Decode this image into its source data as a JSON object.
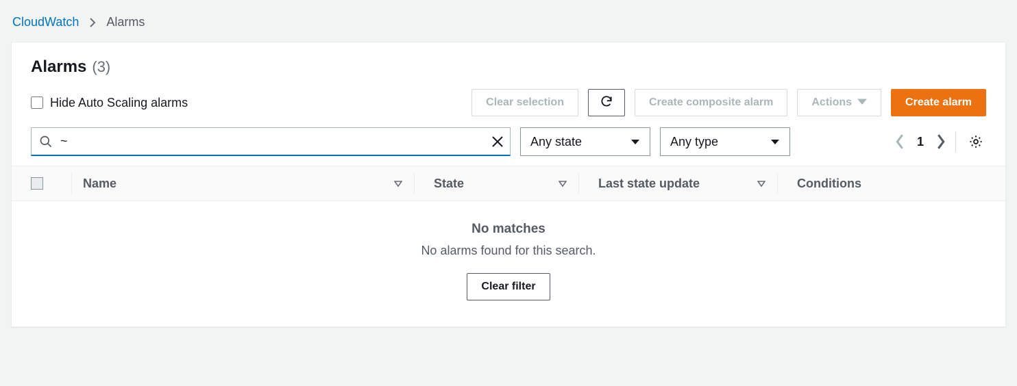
{
  "breadcrumb": {
    "root": "CloudWatch",
    "current": "Alarms"
  },
  "header": {
    "title": "Alarms",
    "count": "(3)"
  },
  "controls": {
    "hide_autoscale_label": "Hide Auto Scaling alarms",
    "clear_selection": "Clear selection",
    "create_composite": "Create composite alarm",
    "actions": "Actions",
    "create_alarm": "Create alarm"
  },
  "filter": {
    "search_value": "~",
    "state_select": "Any state",
    "type_select": "Any type",
    "page": "1"
  },
  "table": {
    "columns": {
      "name": "Name",
      "state": "State",
      "last_update": "Last state update",
      "conditions": "Conditions"
    }
  },
  "empty": {
    "title": "No matches",
    "subtitle": "No alarms found for this search.",
    "clear_filter": "Clear filter"
  }
}
